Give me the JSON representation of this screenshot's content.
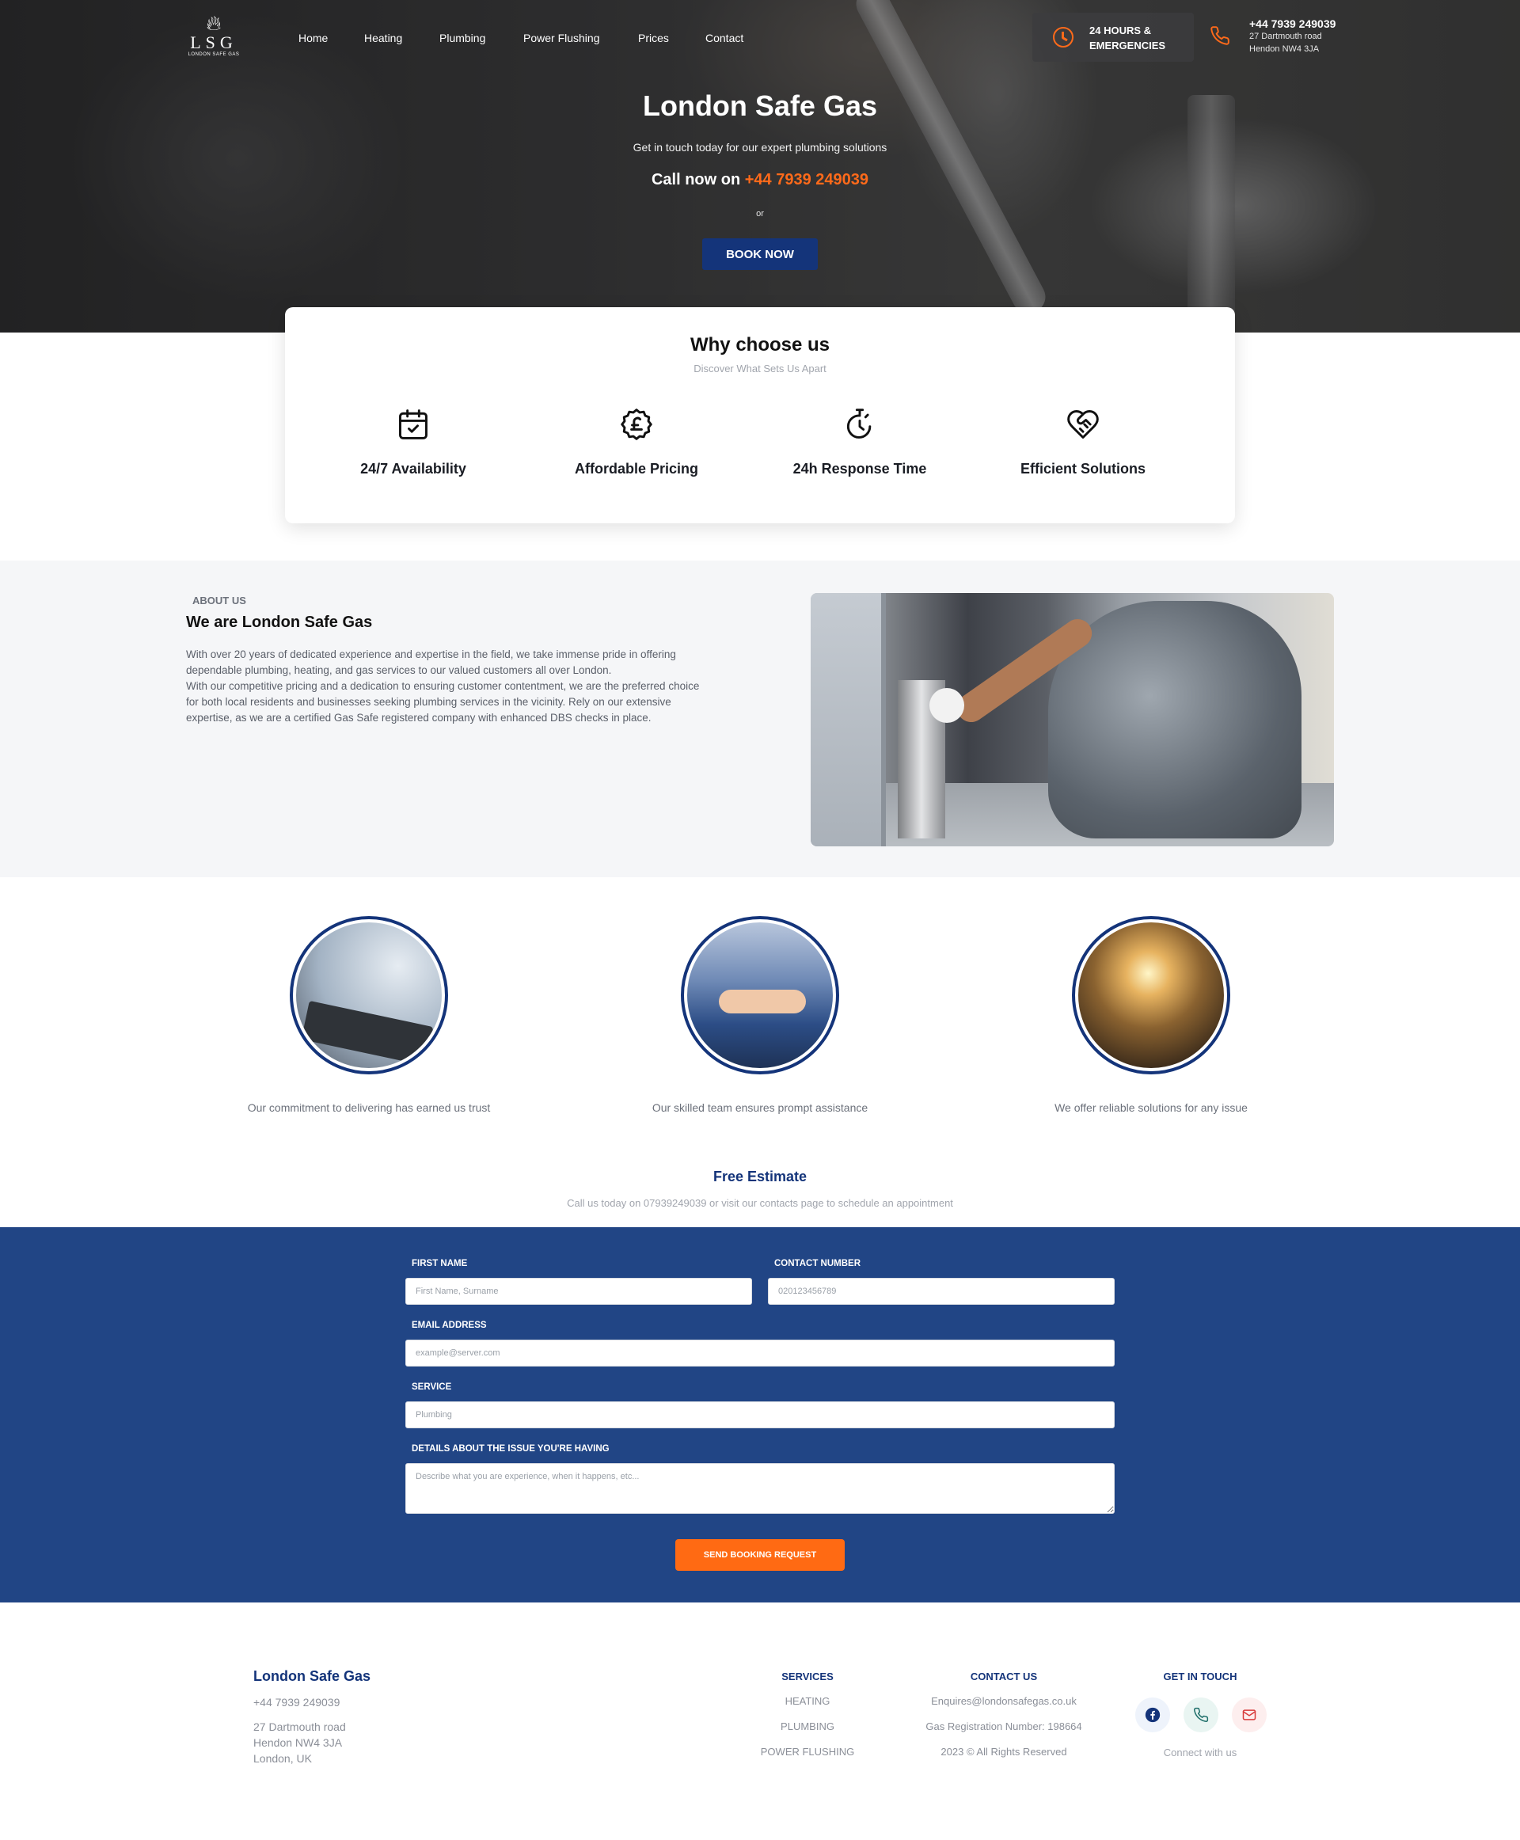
{
  "brand": {
    "logo_mark": "LSG",
    "logo_tagline": "LONDON SAFE GAS",
    "name": "London Safe Gas"
  },
  "nav": {
    "items": [
      "Home",
      "Heating",
      "Plumbing",
      "Power Flushing",
      "Prices",
      "Contact"
    ]
  },
  "header": {
    "hours_line1": "24 HOURS &",
    "hours_line2": "EMERGENCIES",
    "phone": "+44 7939 249039",
    "address_line1": "27 Dartmouth road",
    "address_line2": "Hendon NW4 3JA"
  },
  "hero": {
    "title": "London Safe Gas",
    "subtitle": "Get in touch today for our expert plumbing solutions",
    "call_prefix": "Call now on ",
    "call_number": "+44 7939 249039",
    "or": "or",
    "book_label": "BOOK NOW"
  },
  "why": {
    "title": "Why choose us",
    "subtitle": "Discover What Sets Us Apart",
    "features": [
      {
        "label": "24/7 Availability",
        "icon": "calendar-check-icon"
      },
      {
        "label": "Affordable Pricing",
        "icon": "pound-badge-icon"
      },
      {
        "label": "24h Response Time",
        "icon": "stopwatch-icon"
      },
      {
        "label": "Efficient Solutions",
        "icon": "heart-handshake-icon"
      }
    ]
  },
  "about": {
    "kicker": "ABOUT US",
    "title": "We are London Safe Gas",
    "paragraph1": "With over 20 years of dedicated experience and expertise in the field, we take immense pride in offering dependable plumbing, heating, and gas services to our valued customers all over London.",
    "paragraph2": "With our competitive pricing and a dedication to ensuring customer contentment, we are the preferred choice for both local residents and businesses seeking plumbing services in the vicinity. Rely on our extensive expertise, as we are a certified Gas Safe registered company with enhanced DBS checks in place."
  },
  "values": [
    {
      "caption": "Our commitment to delivering has earned us trust"
    },
    {
      "caption": "Our skilled team ensures prompt assistance"
    },
    {
      "caption": "We offer reliable solutions for any issue"
    }
  ],
  "estimate": {
    "title": "Free Estimate",
    "subtitle": "Call us today on 07939249039 or visit our contacts page to schedule an appointment"
  },
  "form": {
    "first_name_label": "FIRST NAME",
    "first_name_placeholder": "First Name, Surname",
    "contact_label": "CONTACT NUMBER",
    "contact_placeholder": "020123456789",
    "email_label": "EMAIL ADDRESS",
    "email_placeholder": "example@server.com",
    "service_label": "SERVICE",
    "service_placeholder": "Plumbing",
    "details_label": "DETAILS ABOUT THE ISSUE YOU'RE HAVING",
    "details_placeholder": "Describe what you are experience, when it happens, etc...",
    "submit_label": "SEND BOOKING REQUEST"
  },
  "footer": {
    "brand": "London Safe Gas",
    "phone": "+44 7939 249039",
    "address_line1": "27 Dartmouth road",
    "address_line2": "Hendon NW4 3JA",
    "address_line3": "London, UK",
    "services_title": "SERVICES",
    "services": [
      "HEATING",
      "PLUMBING",
      "POWER FLUSHING"
    ],
    "contact_title": "CONTACT US",
    "contact_email": "Enquires@londonsafegas.co.uk",
    "gas_reg": "Gas Registration Number: 198664",
    "copyright": "2023 © All Rights Reserved",
    "touch_title": "GET IN TOUCH",
    "connect": "Connect with us"
  },
  "colors": {
    "navy": "#14347a",
    "form_band": "#214585",
    "accent_orange": "#ff6a13"
  }
}
